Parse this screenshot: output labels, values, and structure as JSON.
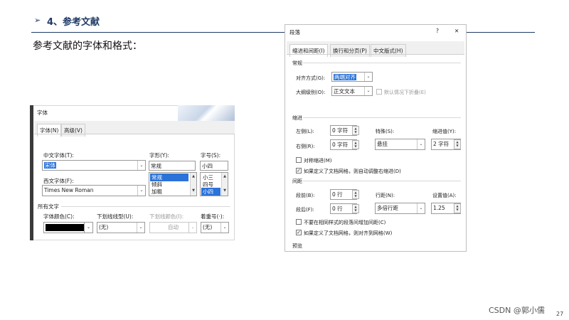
{
  "slide": {
    "arrow_glyph": "➢",
    "section_title": "4、参考文献",
    "intro": "参考文献的字体和格式：",
    "brand": "CSDN @郭小儒",
    "page_number": "27",
    "accent_color": "#1f3a66"
  },
  "font_dialog": {
    "title": "字体",
    "tabs": [
      "字体(N)",
      "高级(V)"
    ],
    "cn_font_label": "中文字体(T):",
    "cn_font_value": "宋体",
    "style_label": "字形(Y):",
    "style_value": "常规",
    "style_options": [
      "常规",
      "倾斜",
      "加粗"
    ],
    "size_label": "字号(S):",
    "size_value": "小四",
    "size_options": [
      "小三",
      "四号",
      "小四"
    ],
    "west_font_label": "西文字体(F):",
    "west_font_value": "Times New Roman",
    "all_text_label": "所有文字",
    "color_label": "字体颜色(C):",
    "underline_label": "下划线线型(U):",
    "underline_value": "(无)",
    "underline_color_label": "下划线颜色(I):",
    "underline_color_value": "自动",
    "emphasis_label": "着重号(·):",
    "emphasis_value": "(无)"
  },
  "para_dialog": {
    "title": "段落",
    "help": "?",
    "close": "✕",
    "tabs": [
      "缩进和间距(I)",
      "换行和分页(P)",
      "中文版式(H)"
    ],
    "general_label": "常规",
    "align_label": "对齐方式(G):",
    "align_value": "两端对齐",
    "outline_label": "大纲级别(O):",
    "outline_value": "正文文本",
    "collapse_label": "默认情况下折叠(E)",
    "indent_label": "缩进",
    "left_label": "左侧(L):",
    "left_value": "0 字符",
    "right_label": "右侧(R):",
    "right_value": "0 字符",
    "special_label": "特殊(S):",
    "special_value": "悬挂",
    "indent_value_label": "缩进值(Y):",
    "indent_value": "2 字符",
    "mirror_label": "对称缩进(M)",
    "auto_indent_label": "如果定义了文档网格，则自动调整右缩进(D)",
    "spacing_label": "间距",
    "before_label": "段前(B):",
    "before_value": "0 行",
    "after_label": "段后(F):",
    "after_value": "0 行",
    "line_spacing_label": "行距(N):",
    "line_spacing_value": "多倍行距",
    "setting_label": "设置值(A):",
    "setting_value": "1.25",
    "no_space_label": "不要在相同样式的段落间增加间距(C)",
    "snap_grid_label": "如果定义了文档网格，则对齐到网格(W)",
    "preview_label": "预览"
  }
}
